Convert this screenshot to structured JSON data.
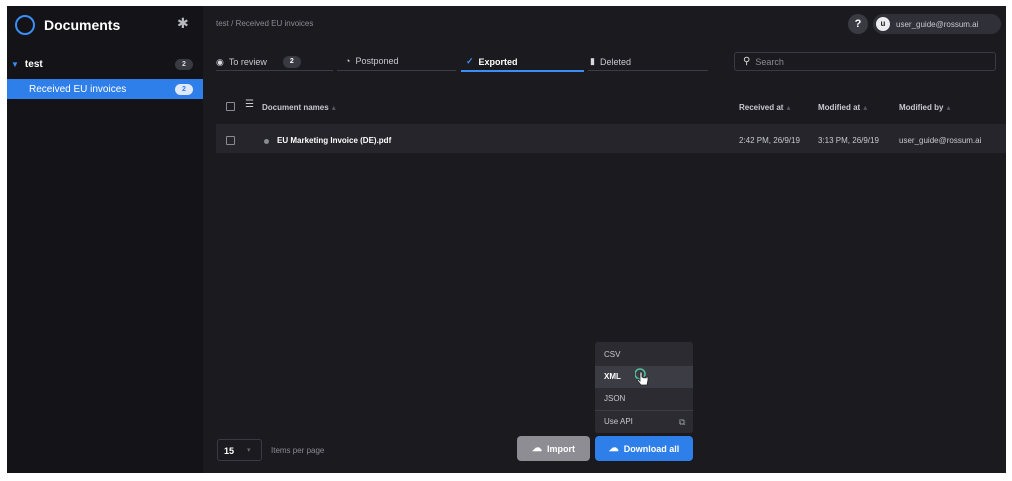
{
  "sidebar": {
    "title": "Documents",
    "tree": {
      "folder": {
        "label": "test",
        "count": "2"
      },
      "queue": {
        "label": "Received EU invoices",
        "count": "2"
      }
    }
  },
  "header": {
    "breadcrumb": "test / Received EU invoices",
    "help": "?",
    "user_initial": "u",
    "user_email": "user_guide@rossum.ai"
  },
  "tabs": [
    {
      "label": "To review",
      "count": "2"
    },
    {
      "label": "Postponed"
    },
    {
      "label": "Exported"
    },
    {
      "label": "Deleted"
    }
  ],
  "search": {
    "placeholder": "Search"
  },
  "table": {
    "columns": [
      "Document names",
      "Received at",
      "Modified at",
      "Modified by"
    ],
    "rows": [
      {
        "name": "EU Marketing Invoice (DE).pdf",
        "received": "2:42 PM, 26/9/19",
        "modified": "3:13 PM, 26/9/19",
        "modified_by": "user_guide@rossum.ai"
      }
    ]
  },
  "footer": {
    "per_page": "15",
    "per_page_label": "Items per page",
    "import": "Import",
    "download": "Download all"
  },
  "download_menu": [
    "CSV",
    "XML",
    "JSON",
    "Use API"
  ],
  "colors": {
    "accent": "#2f7fea",
    "background": "#1b1b1f",
    "sidebar": "#141418"
  }
}
